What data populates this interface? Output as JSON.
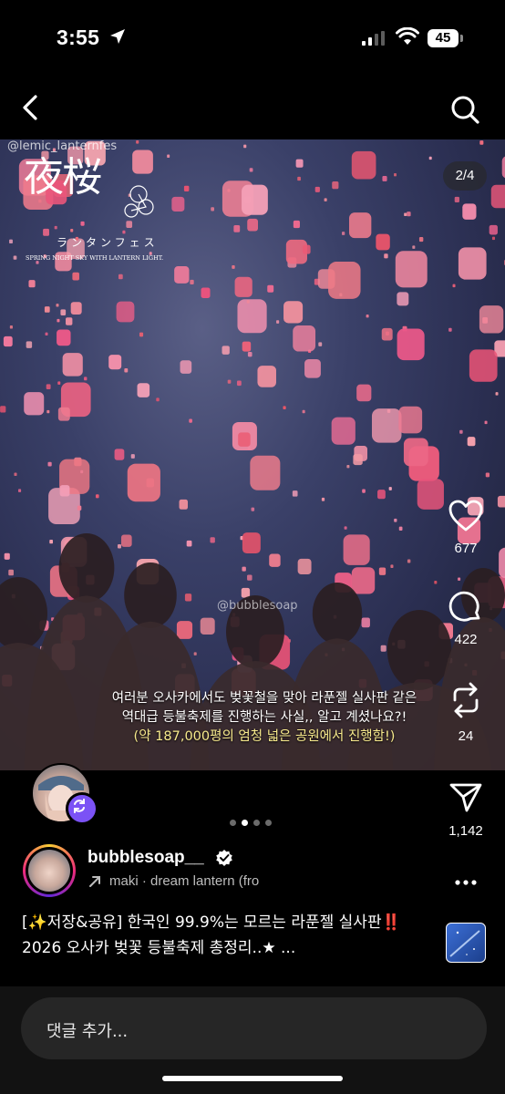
{
  "status": {
    "time": "3:55",
    "battery": "45"
  },
  "media": {
    "watermark_top": "@lemic_lanternfes",
    "logo_kanji": "夜桜",
    "logo_kana": "ランタンフェス",
    "logo_tagline": "SPRING NIGHT SKY WITH LANTERN LIGHT.",
    "counter": "2/4",
    "watermark_mid": "@bubblesoap",
    "caption_line1": "여러분 오사카에서도 벚꽃철을 맞아 라푼젤 실사판 같은",
    "caption_line2": "역대급 등불축제를 진행하는 사실,, 알고 계셨나요?!",
    "caption_line3": "(약 187,000평의 엄청 넓은 공원에서 진행함!)"
  },
  "actions": {
    "likes": "677",
    "comments": "422",
    "reposts": "24",
    "shares": "1,142"
  },
  "author": {
    "username": "bubblesoap__",
    "audio": "maki · dream lantern (fro"
  },
  "post": {
    "caption": "[✨저장&공유] 한국인 99.9%는 모르는 라푼젤 실사판‼️2026 오사카 벚꽃 등불축제 총정리..★ ..."
  },
  "comment": {
    "placeholder": "댓글 추가..."
  },
  "icons": [
    "location-arrow-icon",
    "signal-icon",
    "wifi-icon",
    "battery-icon",
    "back-chevron-icon",
    "search-icon",
    "heart-icon",
    "comment-icon",
    "repost-icon",
    "send-icon",
    "remix-icon",
    "verified-icon",
    "audio-arrow-icon",
    "more-icon"
  ],
  "colors": {
    "background": "#000000",
    "remix_badge": "#7b52f5",
    "caption_highlight": "#f7ea8c",
    "comment_box": "#262626"
  },
  "carousel": {
    "total": 4,
    "current": 2
  }
}
